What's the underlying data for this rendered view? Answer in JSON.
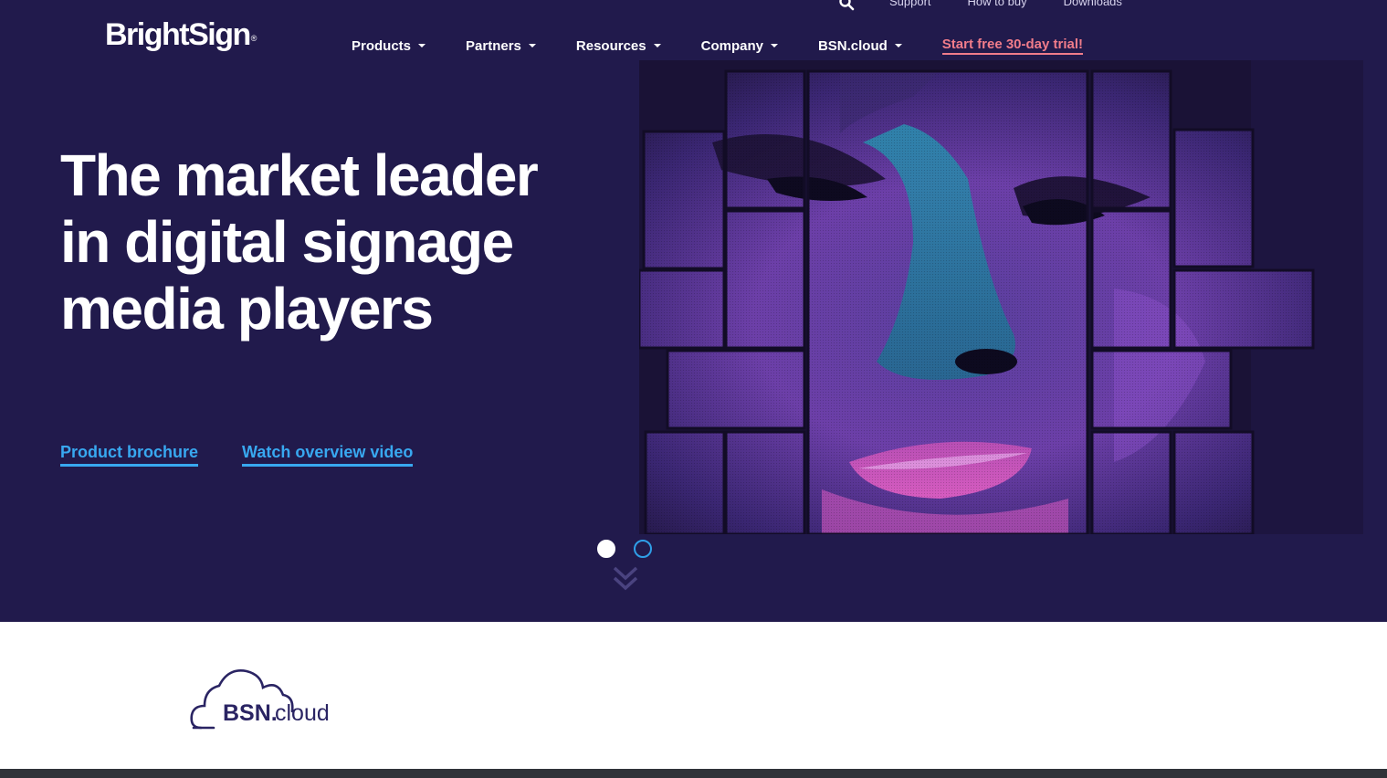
{
  "header": {
    "logo_text": "BrightSign",
    "logo_mark": "®",
    "utility_links": [
      "Support",
      "How to buy",
      "Downloads"
    ],
    "icons": {
      "search": "search-icon"
    }
  },
  "nav": {
    "items": [
      {
        "label": "Products"
      },
      {
        "label": "Partners"
      },
      {
        "label": "Resources"
      },
      {
        "label": "Company"
      },
      {
        "label": "BSN.cloud"
      }
    ],
    "trial_label": "Start free 30-day trial!"
  },
  "hero": {
    "headline": "The market leader in digital signage media players",
    "cta_brochure": "Product brochure",
    "cta_video": "Watch overview video",
    "carousel": {
      "slides": 2,
      "active": 1
    }
  },
  "below": {
    "bsn_logo_bold": "BSN.",
    "bsn_logo_light": "cloud"
  },
  "colors": {
    "hero_bg": "#211a4c",
    "accent_link": "#38a8f0",
    "trial_link": "#f07c8a",
    "footer_bar": "#303339"
  }
}
